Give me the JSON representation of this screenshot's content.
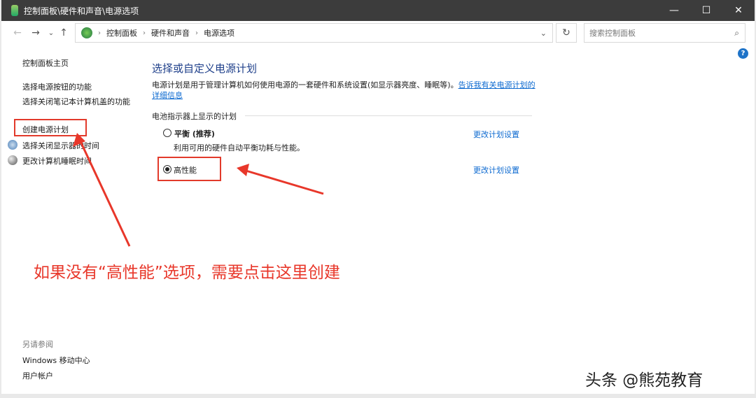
{
  "window": {
    "title": "控制面板\\硬件和声音\\电源选项",
    "min": "—",
    "max": "☐",
    "close": "✕"
  },
  "nav": {
    "back": "←",
    "forward": "→",
    "recent": "⌄",
    "up": "↑",
    "breadcrumbs": [
      "控制面板",
      "硬件和声音",
      "电源选项"
    ],
    "refresh": "↻",
    "search_placeholder": "搜索控制面板",
    "search_icon": "⌕",
    "dropdown": "⌄"
  },
  "sidebar": {
    "home": "控制面板主页",
    "items": [
      "选择电源按钮的功能",
      "选择关闭笔记本计算机盖的功能",
      "创建电源计划",
      "选择关闭显示器的时间",
      "更改计算机睡眠时间"
    ],
    "see_also": "另请参阅",
    "links": [
      "Windows 移动中心",
      "用户帐户"
    ]
  },
  "main": {
    "title": "选择或自定义电源计划",
    "desc": "电源计划是用于管理计算机如何使用电源的一套硬件和系统设置(如显示器亮度、睡眠等)。",
    "desc_link": "告诉我有关电源计划的详细信息",
    "group": "电池指示器上显示的计划",
    "plans": [
      {
        "name": "平衡 (推荐)",
        "desc": "利用可用的硬件自动平衡功耗与性能。",
        "selected": false,
        "link": "更改计划设置"
      },
      {
        "name": "高性能",
        "selected": true,
        "link": "更改计划设置"
      }
    ]
  },
  "annotation": "如果没有“高性能”选项，需要点击这里创建",
  "watermark": "头条 @熊苑教育",
  "help": "?"
}
